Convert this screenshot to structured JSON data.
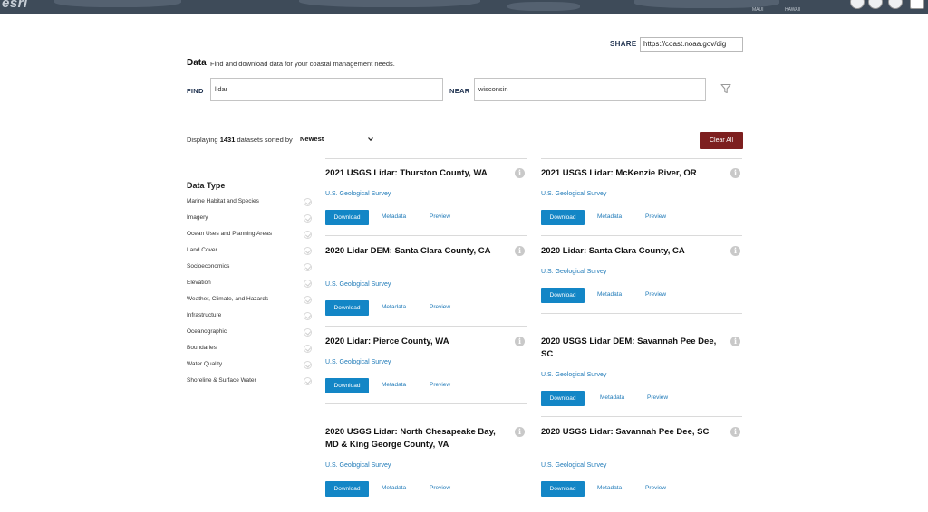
{
  "banner": {
    "logo": "esri",
    "map_labels": [
      "MAUI",
      "HAWAII"
    ]
  },
  "share": {
    "label": "SHARE",
    "url": "https://coast.noaa.gov/dig"
  },
  "header": {
    "title": "Data",
    "subtitle": "Find and download data for your coastal management needs."
  },
  "search": {
    "find_label": "FIND",
    "find_value": "lidar",
    "near_label": "NEAR",
    "near_value": "wisconsin"
  },
  "results": {
    "prefix": "Displaying",
    "count": "1431",
    "suffix": "datasets sorted by",
    "sort_value": "Newest",
    "clear_label": "Clear All"
  },
  "facets": {
    "title": "Data Type",
    "items": [
      "Marine Habitat and Species",
      "Imagery",
      "Ocean Uses and Planning Areas",
      "Land Cover",
      "Socioeconomics",
      "Elevation",
      "Weather, Climate, and Hazards",
      "Infrastructure",
      "Oceanographic",
      "Boundaries",
      "Water Quality",
      "Shoreline & Surface Water"
    ]
  },
  "card_actions": {
    "download": "Download",
    "metadata": "Metadata",
    "preview": "Preview"
  },
  "cards": [
    {
      "title": "2021 USGS Lidar: Thurston County, WA",
      "org": "U.S. Geological Survey"
    },
    {
      "title": "2021 USGS Lidar: McKenzie River, OR",
      "org": "U.S. Geological Survey"
    },
    {
      "title": "2020 Lidar DEM: Santa Clara County, CA",
      "org": "U.S. Geological Survey"
    },
    {
      "title": "2020 Lidar: Santa Clara County, CA",
      "org": "U.S. Geological Survey"
    },
    {
      "title": "2020 Lidar: Pierce County, WA",
      "org": "U.S. Geological Survey"
    },
    {
      "title": "2020 USGS Lidar DEM: Savannah Pee Dee, SC",
      "org": "U.S. Geological Survey"
    },
    {
      "title": "2020 USGS Lidar: North Chesapeake Bay, MD & King George County, VA",
      "org": "U.S. Geological Survey"
    },
    {
      "title": "2020 USGS Lidar: Savannah Pee Dee, SC",
      "org": "U.S. Geological Survey"
    }
  ],
  "colors": {
    "download": "#1386c6",
    "clear": "#7d1f1f",
    "link": "#1f7ab8",
    "navy": "#1c2f4d"
  }
}
